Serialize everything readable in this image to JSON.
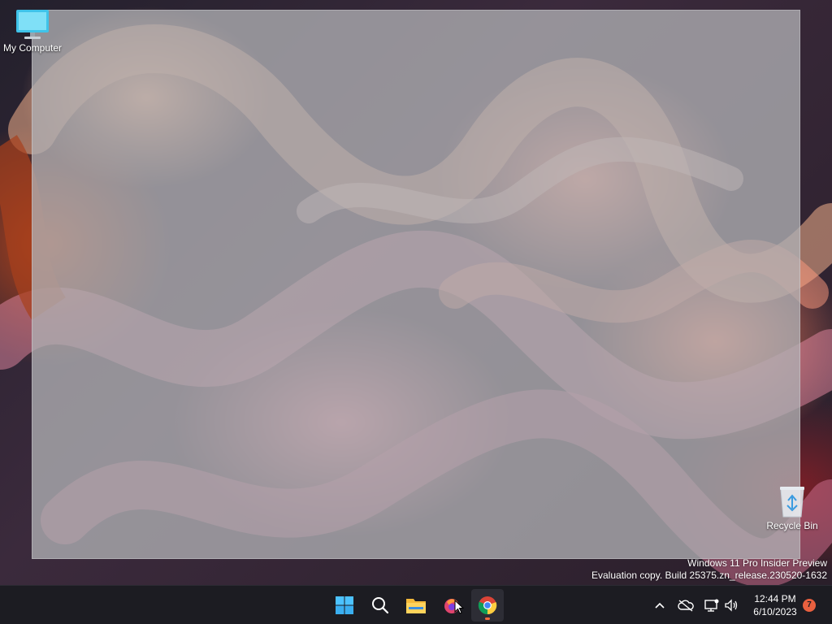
{
  "desktop": {
    "icons": [
      {
        "label": "My Computer",
        "icon": "computer-icon"
      },
      {
        "label": "Recycle Bin",
        "icon": "recycle-bin-icon"
      }
    ],
    "watermark": {
      "line1": "Windows 11 Pro Insider Preview",
      "line2": "Evaluation copy. Build 25375.zn_release.230520-1632"
    }
  },
  "taskbar": {
    "apps": [
      {
        "name": "Start",
        "icon": "windows-start-icon"
      },
      {
        "name": "Search",
        "icon": "search-icon"
      },
      {
        "name": "File Explorer",
        "icon": "folder-icon"
      },
      {
        "name": "App",
        "icon": "app-icon"
      },
      {
        "name": "Google Chrome",
        "icon": "chrome-icon",
        "active": true
      }
    ],
    "tray": {
      "icons": [
        "chevron-up-icon",
        "cloud-off-icon",
        "network-icon",
        "volume-icon"
      ],
      "time": "12:44 PM",
      "date": "6/10/2023",
      "notification_count": "7"
    }
  },
  "colors": {
    "taskbar_bg": "#1c1c22",
    "accent": "#f76a3c",
    "overlay": "#afafb4"
  }
}
